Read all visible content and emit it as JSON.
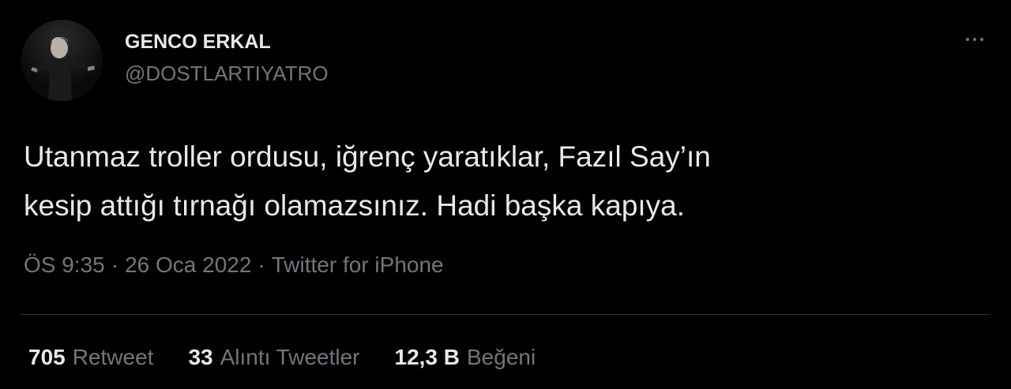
{
  "author": {
    "display_name": "GENCO ERKAL",
    "handle": "@DOSTLARTIYATRO",
    "avatar_icon": "profile-photo"
  },
  "header": {
    "more_icon": "more-horizontal-icon"
  },
  "tweet": {
    "text_lines": [
      "Utanmaz troller ordusu, iğrenç yaratıklar, Fazıl Say’ın",
      "kesip attığı tırnağı olamazsınız. Hadi başka kapıya."
    ],
    "time": "ÖS 9:35",
    "date": "26 Oca 2022",
    "separator": "·",
    "source": "Twitter for iPhone"
  },
  "stats": {
    "retweets": {
      "count": "705",
      "label": "Retweet"
    },
    "quotes": {
      "count": "33",
      "label": "Alıntı Tweetler"
    },
    "likes": {
      "count": "12,3 B",
      "label": "Beğeni"
    }
  },
  "colors": {
    "background": "#000000",
    "primary_text": "#e7e9ea",
    "secondary_text": "#71767b",
    "divider": "#2f3336"
  }
}
